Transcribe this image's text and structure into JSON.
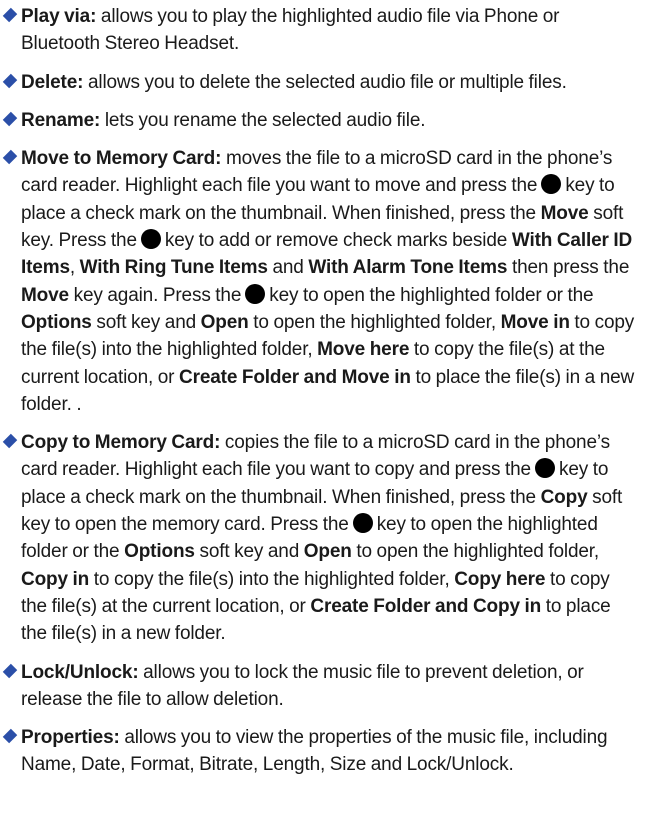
{
  "items": [
    {
      "term": "Play via:",
      "text": "allows you to play the highlighted audio file via Phone or Bluetooth Stereo Headset."
    },
    {
      "term": "Delete:",
      "text": "allows you to delete the selected audio file or multiple files."
    },
    {
      "term": "Rename:",
      "text": "lets you rename the selected audio file."
    },
    {
      "term": "Move to Memory Card:",
      "p1": "moves the file to a microSD card in the phone’s card reader. Highlight each file you want to move and press the",
      "p2": "key to place a check mark on the thumbnail. When finished, press the",
      "b1": "Move",
      "p3": "soft key. Press the",
      "p4": "key to add or remove check marks beside",
      "b2": "With Caller ID Items",
      "p5": ",",
      "b3": "With Ring Tune Items",
      "p6": "and",
      "b4": "With Alarm Tone Items",
      "p7": "then press the",
      "b5": "Move",
      "p8": "key again. Press the",
      "p9": "key to open the highlighted folder or the",
      "b6": "Options",
      "p10": "soft key and",
      "b7": "Open",
      "p11": "to open the highlighted folder,",
      "b8": "Move in",
      "p12": "to copy the file(s) into the highlighted folder,",
      "b9": "Move here",
      "p13": "to copy the file(s) at the current location, or",
      "b10": "Create Folder and Move in",
      "p14": "to place the file(s) in a new folder. ."
    },
    {
      "term": "Copy to Memory Card:",
      "p1": "copies the file to a microSD card in the phone’s card reader. Highlight each file you want to copy and press the",
      "p2": "key to place a check mark on the thumbnail. When finished, press the",
      "b1": "Copy",
      "p3": "soft key to open the memory card. Press the",
      "p4": "key to open the highlighted folder or the",
      "b2": "Options",
      "p5": "soft key and",
      "b3": "Open",
      "p6": "to open the highlighted folder,",
      "b4": "Copy in",
      "p7": "to copy the file(s) into the highlighted folder,",
      "b5": "Copy here",
      "p8": "to copy the file(s) at the current location, or",
      "b6": "Create Folder and Copy in",
      "p9": "to place the file(s) in a new folder."
    },
    {
      "term": "Lock/Unlock:",
      "text": "allows you to lock the music file to prevent deletion, or release the file to allow deletion."
    },
    {
      "term": "Properties:",
      "text": "allows you to view the properties of the music file, including Name, Date, Format, Bitrate, Length, Size and Lock/Unlock."
    }
  ]
}
